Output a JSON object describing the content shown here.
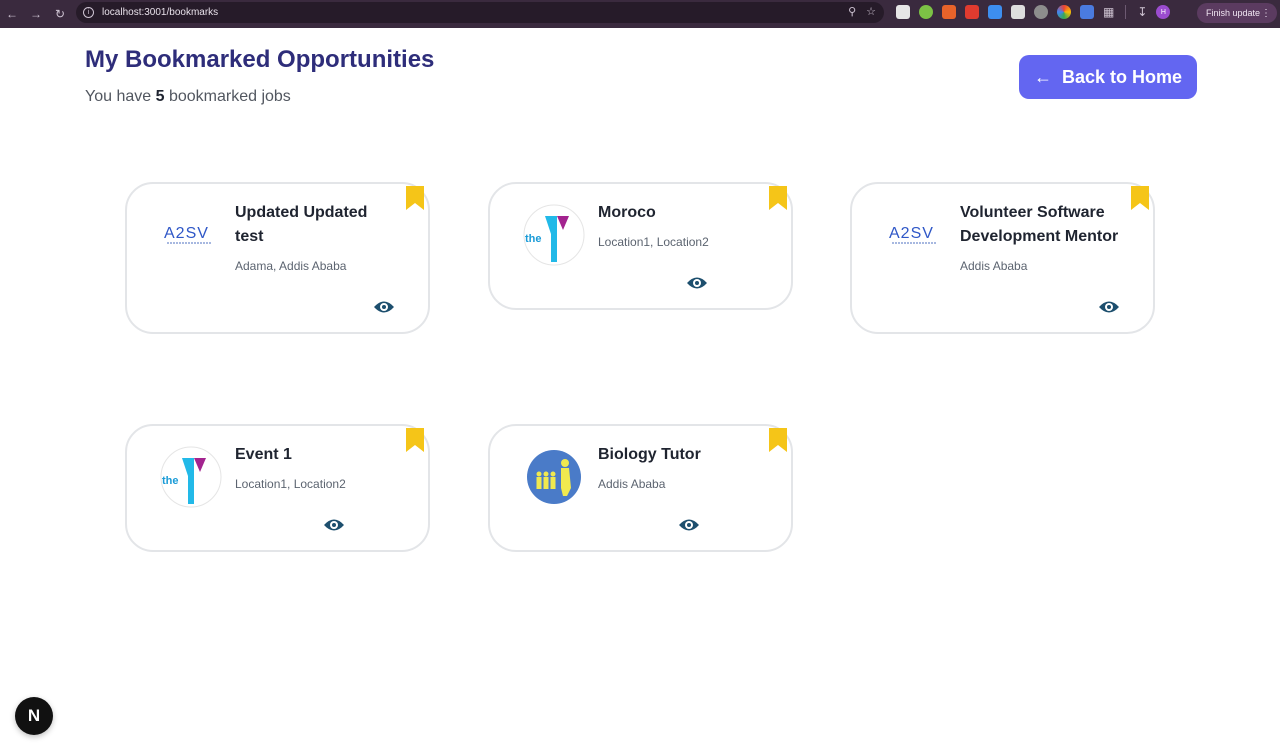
{
  "browser": {
    "url": "localhost:3001/bookmarks",
    "finish_update_label": "Finish update",
    "profile_initial": "H"
  },
  "header": {
    "title": "My Bookmarked Opportunities",
    "subtitle_prefix": "You have",
    "count": "5",
    "subtitle_suffix": "bookmarked jobs",
    "back_label": "Back to Home"
  },
  "cards": [
    {
      "title": "Updated Updated test",
      "location": "Adama, Addis Ababa",
      "logo": "a2sv-logo"
    },
    {
      "title": "Moroco",
      "location": "Location1, Location2",
      "logo": "the-y-logo"
    },
    {
      "title": "Volunteer Software Development Mentor",
      "location": "Addis Ababa",
      "logo": "a2sv-logo"
    },
    {
      "title": "Event 1",
      "location": "Location1, Location2",
      "logo": "the-y-logo"
    },
    {
      "title": "Biology Tutor",
      "location": "Addis Ababa",
      "logo": "family-logo"
    }
  ],
  "logo_texts": {
    "a2sv": "A2SV",
    "the_y": "the"
  },
  "colors": {
    "accent": "#6366f1",
    "title": "#2e2d7a",
    "bookmark": "#f5c518",
    "eye": "#1d4f6e"
  },
  "next_badge": "N"
}
